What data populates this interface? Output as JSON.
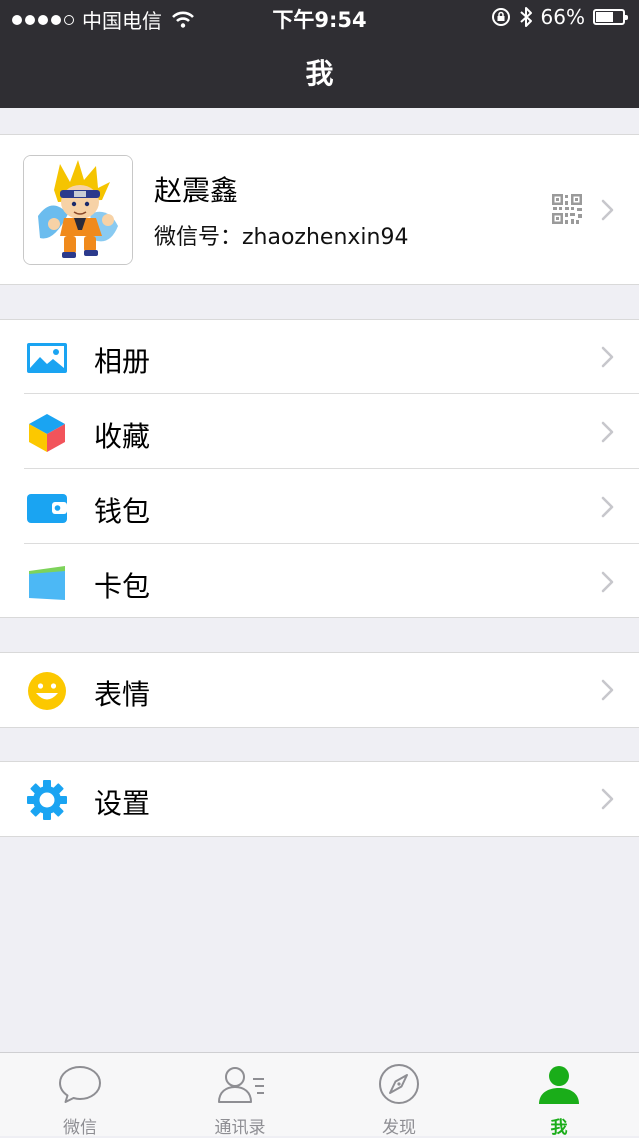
{
  "status_bar": {
    "carrier": "中国电信",
    "time": "下午9:54",
    "battery_text": "66%",
    "battery_level": 0.66,
    "icons": [
      "signal-icon",
      "wifi-icon",
      "rotation-lock-icon",
      "bluetooth-icon",
      "battery-icon"
    ]
  },
  "nav": {
    "title": "我"
  },
  "profile": {
    "name": "赵震鑫",
    "wechat_id": "微信号：zhaozhenxin94",
    "icons": [
      "avatar-image",
      "qr-code-icon",
      "chevron-right-icon"
    ]
  },
  "menu": {
    "album": {
      "label": "相册",
      "icon": "album-icon"
    },
    "favorites": {
      "label": "收藏",
      "icon": "favorites-cube-icon"
    },
    "wallet": {
      "label": "钱包",
      "icon": "wallet-icon"
    },
    "cards": {
      "label": "卡包",
      "icon": "card-pack-icon"
    },
    "stickers": {
      "label": "表情",
      "icon": "smiley-icon"
    },
    "settings": {
      "label": "设置",
      "icon": "gear-icon"
    }
  },
  "tabbar": {
    "chats": {
      "label": "微信",
      "icon": "chat-bubble-icon"
    },
    "contacts": {
      "label": "通讯录",
      "icon": "contacts-icon"
    },
    "discover": {
      "label": "发现",
      "icon": "compass-icon"
    },
    "me": {
      "label": "我",
      "icon": "person-icon",
      "active": true
    }
  },
  "colors": {
    "nav_background": "#2f2e33",
    "page_background": "#efeff4",
    "active_tab": "#1aad19",
    "icon_blue": "#1aa4f2",
    "smiley_yellow": "#fcc800"
  }
}
